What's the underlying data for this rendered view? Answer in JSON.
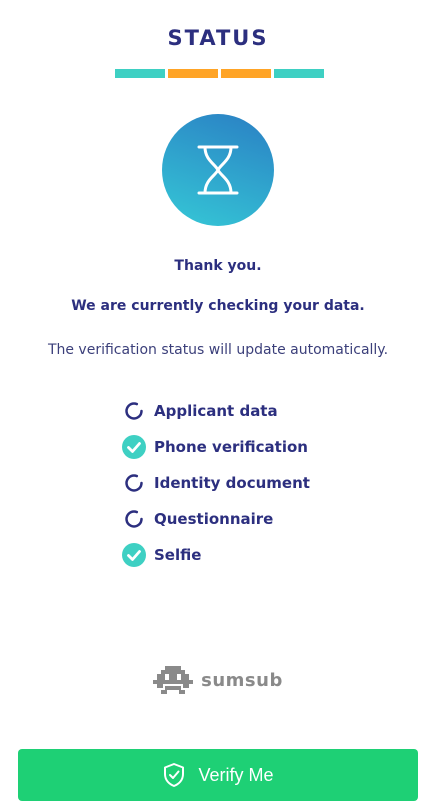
{
  "header": {
    "title": "STATUS"
  },
  "progress": {
    "segments": [
      {
        "color": "#3ed0c3"
      },
      {
        "color": "#ffa426"
      },
      {
        "color": "#ffa426"
      },
      {
        "color": "#3ed0c3"
      }
    ]
  },
  "status_icon": "hourglass-icon",
  "messages": {
    "thank_you": "Thank you.",
    "checking": "We are currently checking your data.",
    "auto_update": "The verification status will update automatically."
  },
  "steps": [
    {
      "label": "Applicant data",
      "state": "pending",
      "icon": "spinner-icon"
    },
    {
      "label": "Phone verification",
      "state": "done",
      "icon": "check-circle-icon"
    },
    {
      "label": "Identity document",
      "state": "pending",
      "icon": "spinner-icon"
    },
    {
      "label": "Questionnaire",
      "state": "pending",
      "icon": "spinner-icon"
    },
    {
      "label": "Selfie",
      "state": "done",
      "icon": "check-circle-icon"
    }
  ],
  "brand": {
    "name": "sumsub",
    "icon": "sumsub-logo-icon"
  },
  "actions": {
    "verify_label": "Verify Me",
    "verify_icon": "shield-check-icon"
  },
  "colors": {
    "primary": "#2c2f7f",
    "accent": "#3ed0c3",
    "button": "#1ed075",
    "warning": "#ffa426"
  }
}
